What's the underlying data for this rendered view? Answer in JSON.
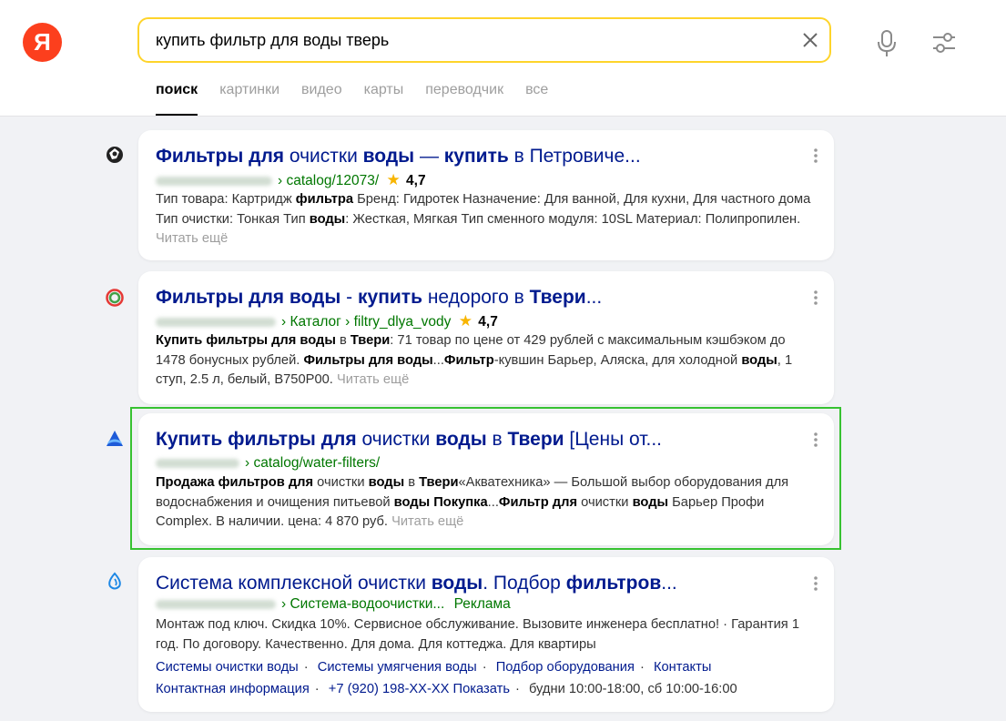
{
  "header": {
    "logo_letter": "Я",
    "search": {
      "value": "купить фильтр для воды тверь"
    },
    "tabs": [
      "поиск",
      "картинки",
      "видео",
      "карты",
      "переводчик",
      "все"
    ]
  },
  "results": [
    {
      "title_parts": [
        {
          "t": "Фильтры для",
          "b": true
        },
        {
          "t": " очистки ",
          "b": false
        },
        {
          "t": "воды",
          "b": true
        },
        {
          "t": " — ",
          "b": false
        },
        {
          "t": "купить",
          "b": true
        },
        {
          "t": " в Петровиче...",
          "b": false
        }
      ],
      "breadcrumb": "catalog/12073/",
      "rating": "4,7",
      "snippet_parts": [
        {
          "t": "Тип товара: Картридж ",
          "b": false
        },
        {
          "t": "фильтра",
          "b": true
        },
        {
          "t": " Бренд: Гидротек Назначение: Для ванной, Для кухни, Для частного дома Тип очистки: Тонкая Тип ",
          "b": false
        },
        {
          "t": "воды",
          "b": true
        },
        {
          "t": ": Жесткая, Мягкая Тип сменного модуля: 10SL Материал: Полипропилен.",
          "b": false
        }
      ],
      "read_more": "Читать ещё"
    },
    {
      "title_parts": [
        {
          "t": "Фильтры для воды",
          "b": true
        },
        {
          "t": " - ",
          "b": false
        },
        {
          "t": "купить",
          "b": true
        },
        {
          "t": " недорого в ",
          "b": false
        },
        {
          "t": "Твери",
          "b": true
        },
        {
          "t": "...",
          "b": false
        }
      ],
      "breadcrumb": "Каталог › filtry_dlya_vody",
      "rating": "4,7",
      "snippet_parts": [
        {
          "t": "Купить фильтры для воды",
          "b": true
        },
        {
          "t": " в ",
          "b": false
        },
        {
          "t": "Твери",
          "b": true
        },
        {
          "t": ": 71 товар по цене от 429 рублей с максимальным кэшбэком до 1478 бонусных рублей. ",
          "b": false
        },
        {
          "t": "Фильтры для воды",
          "b": true
        },
        {
          "t": "...",
          "b": false
        },
        {
          "t": "Фильтр",
          "b": true
        },
        {
          "t": "-кувшин Барьер, Аляска, для холодной ",
          "b": false
        },
        {
          "t": "воды",
          "b": true
        },
        {
          "t": ", 1 ступ, 2.5 л, белый, В750Р00.",
          "b": false
        }
      ],
      "read_more": "Читать ещё"
    },
    {
      "title_parts": [
        {
          "t": "Купить фильтры для",
          "b": true
        },
        {
          "t": " очистки ",
          "b": false
        },
        {
          "t": "воды",
          "b": true
        },
        {
          "t": " в ",
          "b": false
        },
        {
          "t": "Твери",
          "b": true
        },
        {
          "t": " [Цены от...",
          "b": false
        }
      ],
      "breadcrumb": "catalog/water-filters/",
      "rating": "",
      "snippet_parts": [
        {
          "t": "Продажа фильтров для",
          "b": true
        },
        {
          "t": " очистки ",
          "b": false
        },
        {
          "t": "воды",
          "b": true
        },
        {
          "t": " в ",
          "b": false
        },
        {
          "t": "Твери",
          "b": true
        },
        {
          "t": "«Акватехника» — Большой выбор оборудования для водоснабжения и очищения питьевой ",
          "b": false
        },
        {
          "t": "воды Покупка",
          "b": true
        },
        {
          "t": "...",
          "b": false
        },
        {
          "t": "Фильтр для",
          "b": true
        },
        {
          "t": " очистки ",
          "b": false
        },
        {
          "t": "воды",
          "b": true
        },
        {
          "t": " Барьер Профи Complex. В наличии. цена: 4 870 руб.",
          "b": false
        }
      ],
      "read_more": "Читать ещё"
    },
    {
      "title_parts": [
        {
          "t": "Система комплексной очистки ",
          "b": false
        },
        {
          "t": "воды",
          "b": true
        },
        {
          "t": ". Подбор ",
          "b": false
        },
        {
          "t": "фильтров",
          "b": true
        },
        {
          "t": "...",
          "b": false
        }
      ],
      "breadcrumb": "Система-водоочистки...",
      "ad_label": "Реклама",
      "rating": "",
      "snippet_parts": [
        {
          "t": "Монтаж под ключ. Скидка 10%. Сервисное обслуживание. Вызовите инженера бесплатно! · Гарантия 1 год. По договору. Качественно. Для дома. Для коттеджа. Для квартиры",
          "b": false
        }
      ],
      "read_more": "",
      "sitelinks": [
        "Системы очистки воды",
        "Системы умягчения воды",
        "Подбор оборудования",
        "Контакты"
      ],
      "contacts": {
        "info": "Контактная информация",
        "phone": "+7 (920) 198-XX-XX Показать",
        "hours": "будни 10:00-18:00, сб 10:00-16:00"
      }
    }
  ]
}
